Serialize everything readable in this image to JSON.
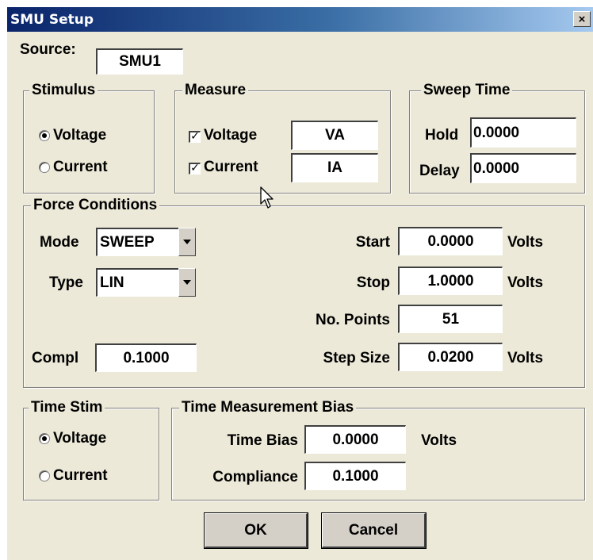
{
  "window": {
    "title": "SMU Setup",
    "close_glyph": "×"
  },
  "source": {
    "label": "Source:",
    "value": "SMU1"
  },
  "stimulus": {
    "title": "Stimulus",
    "options": [
      {
        "label": "Voltage",
        "selected": true
      },
      {
        "label": "Current",
        "selected": false
      }
    ]
  },
  "measure": {
    "title": "Measure",
    "items": [
      {
        "label": "Voltage",
        "checked": true,
        "name": "VA"
      },
      {
        "label": "Current",
        "checked": true,
        "name": "IA"
      }
    ]
  },
  "sweep_time": {
    "title": "Sweep Time",
    "hold_label": "Hold",
    "hold_value": "0.0000",
    "delay_label": "Delay",
    "delay_value": "0.0000"
  },
  "force": {
    "title": "Force Conditions",
    "mode_label": "Mode",
    "mode_value": "SWEEP",
    "type_label": "Type",
    "type_value": "LIN",
    "compl_label": "Compl",
    "compl_value": "0.1000",
    "start_label": "Start",
    "start_value": "0.0000",
    "start_unit": "Volts",
    "stop_label": "Stop",
    "stop_value": "1.0000",
    "stop_unit": "Volts",
    "points_label": "No. Points",
    "points_value": "51",
    "step_label": "Step Size",
    "step_value": "0.0200",
    "step_unit": "Volts"
  },
  "time_stim": {
    "title": "Time Stim",
    "options": [
      {
        "label": "Voltage",
        "selected": true
      },
      {
        "label": "Current",
        "selected": false
      }
    ]
  },
  "time_bias": {
    "title": "Time Measurement Bias",
    "bias_label": "Time Bias",
    "bias_value": "0.0000",
    "bias_unit": "Volts",
    "compliance_label": "Compliance",
    "compliance_value": "0.1000"
  },
  "buttons": {
    "ok": "OK",
    "cancel": "Cancel"
  },
  "icons": {
    "close": "close-icon",
    "dropdown": "chevron-down-icon",
    "cursor": "mouse-pointer-icon"
  },
  "colors": {
    "dialog_bg": "#ece9d8",
    "title_start": "#0a246a",
    "title_end": "#a6caf0"
  }
}
